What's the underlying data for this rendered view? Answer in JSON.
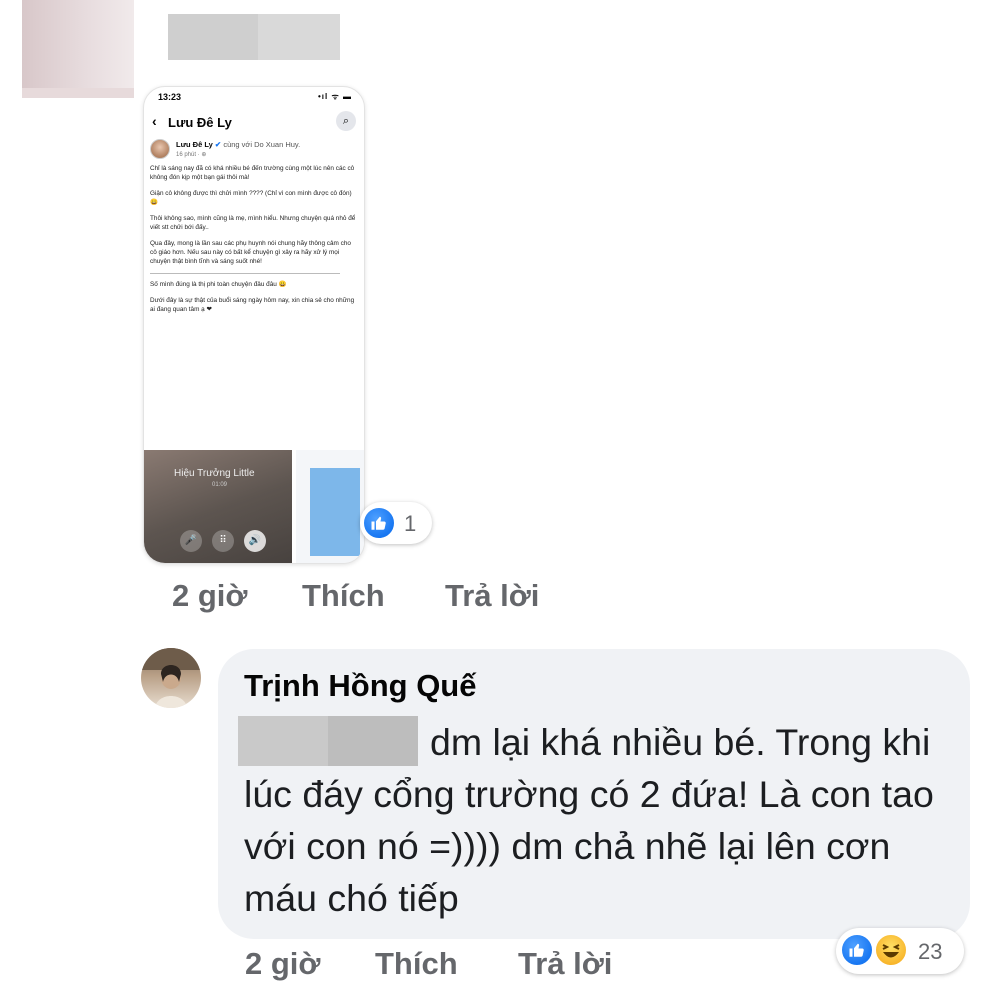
{
  "phone": {
    "status_time": "13:23",
    "signal": "•ıl ᯤ ▬",
    "header_title": "Lưu Đê Ly",
    "back_icon": "‹",
    "search_icon": "⌕",
    "post_author": "Lưu Đê Ly",
    "post_with": "cùng với Do Xuan Huy.",
    "post_time": "16 phút · ⊕",
    "post_paragraphs": [
      "Chỉ là sáng nay đã có khá nhiều bé đến trường cùng một lúc nên các cô không đón kịp một bạn gái thôi mà!",
      "Giận cô không được thì chửi mình ???? (Chỉ vì con mình được cô đón) 😀",
      "Thôi không sao, mình cũng là mẹ, mình hiểu. Nhưng chuyện quá nhỏ để viết stt chửi bới đấy..",
      "Qua đây, mong là lần sau các phụ huynh nói chung hãy thông cảm cho cô giáo hơn. Nếu sau này có bất kể chuyện gì xảy ra hãy xử lý mọi chuyện thật bình tĩnh và sáng suốt nhé!"
    ],
    "post_after_divider": [
      "Số mình đúng là thị phi toàn chuyện đâu đâu 😀",
      "Dưới đây là sự thật của buổi sáng ngày hôm nay, xin chia sẻ cho những ai đang quan tâm ạ ❤"
    ],
    "call_name": "Hiệu Trưởng Little",
    "call_time": "01:09",
    "call_buttons": [
      "🎤",
      "⠿",
      "🔊",
      "+",
      "▶",
      "◉"
    ],
    "tabs": [
      "⌂",
      "▷",
      "▦",
      "☺",
      "🔔",
      "≡"
    ]
  },
  "post_reactions": {
    "count": "1",
    "icon": "like-icon"
  },
  "post_actions": {
    "time": "2 giờ",
    "like": "Thích",
    "reply": "Trả lời"
  },
  "comment": {
    "author": "Trịnh Hồng Quế",
    "text": "dm lại khá nhiều bé. Trong khi lúc đáy cổng trường có 2 đứa! Là con tao với con nó =)))) dm chả nhẽ lại lên cơn máu chó tiếp",
    "reactions_count": "23",
    "reaction_icons": [
      "like-icon",
      "haha-icon"
    ]
  },
  "comment_actions": {
    "time": "2 giờ",
    "like": "Thích",
    "reply": "Trả lời"
  },
  "colors": {
    "facebook_blue": "#1877f2",
    "muted_text": "#65676b",
    "bubble_bg": "#f0f2f5"
  }
}
